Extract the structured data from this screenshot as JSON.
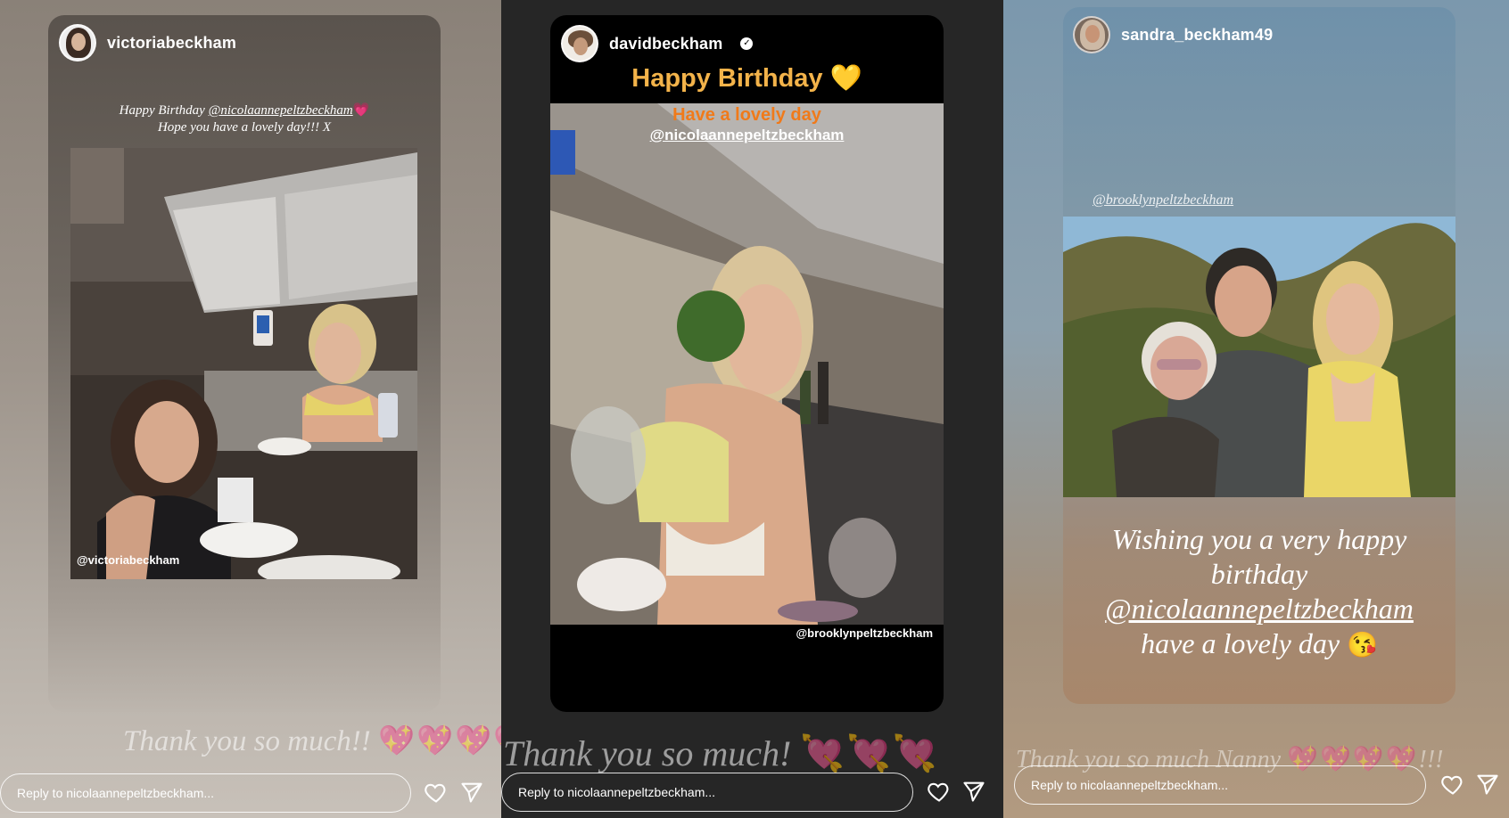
{
  "stories": [
    {
      "username": "victoriabeckham",
      "caption_line1": "Happy Birthday",
      "caption_mention": "@nicolaannepeltzbeckham",
      "caption_emoji": "💗",
      "caption_line2": "Hope you have a lovely day!!! X",
      "photo_tag": "@victoriabeckham",
      "thanks": "Thank you so much!!",
      "thanks_emoji": "💖💖💖💖",
      "reply_placeholder": "Reply to nicolaannepeltzbeckham..."
    },
    {
      "username": "davidbeckham",
      "title": "Happy Birthday",
      "title_emoji": "💛",
      "subtitle": "Have a lovely day",
      "mention": "@nicolaannepeltzbeckham",
      "photo_tag": "@brooklynpeltzbeckham",
      "thanks": "Thank you so much!",
      "thanks_emoji": "💘💘💘",
      "reply_placeholder": "Reply to nicolaannepeltzbeckham..."
    },
    {
      "username": "sandra_beckham49",
      "photo_tag": "@brooklynpeltzbeckham",
      "wish_line1": "Wishing you a very happy",
      "wish_line2": "birthday",
      "wish_mention": "@nicolaannepeltzbeckham",
      "wish_line3": "have a lovely day",
      "wish_emoji": "😘",
      "thanks": "Thank you so much Nanny",
      "thanks_emoji": "💖💖💖💖",
      "thanks_tail": "!!!",
      "reply_placeholder": "Reply to nicolaannepeltzbeckham..."
    }
  ],
  "colors": {
    "accent_gold": "#f3b34a",
    "accent_orange": "#f07a1a",
    "panel_dark": "#262626"
  },
  "icons": [
    "heart-icon",
    "send-icon",
    "verified-icon"
  ]
}
